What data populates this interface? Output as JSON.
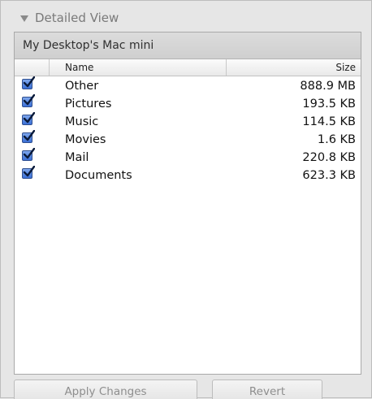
{
  "disclosure": {
    "label": "Detailed View"
  },
  "panel": {
    "title": "My Desktop's Mac mini",
    "columns": {
      "name": "Name",
      "size": "Size"
    },
    "rows": [
      {
        "name": "Other",
        "size": "888.9 MB",
        "checked": true
      },
      {
        "name": "Pictures",
        "size": "193.5 KB",
        "checked": true
      },
      {
        "name": "Music",
        "size": "114.5 KB",
        "checked": true
      },
      {
        "name": "Movies",
        "size": "1.6 KB",
        "checked": true
      },
      {
        "name": "Mail",
        "size": "220.8 KB",
        "checked": true
      },
      {
        "name": "Documents",
        "size": "623.3 KB",
        "checked": true
      }
    ]
  },
  "buttons": {
    "apply": "Apply Changes",
    "revert": "Revert"
  },
  "icons": {
    "disclosure": "disclosure-triangle-icon",
    "checkbox": "checkmark-icon"
  }
}
